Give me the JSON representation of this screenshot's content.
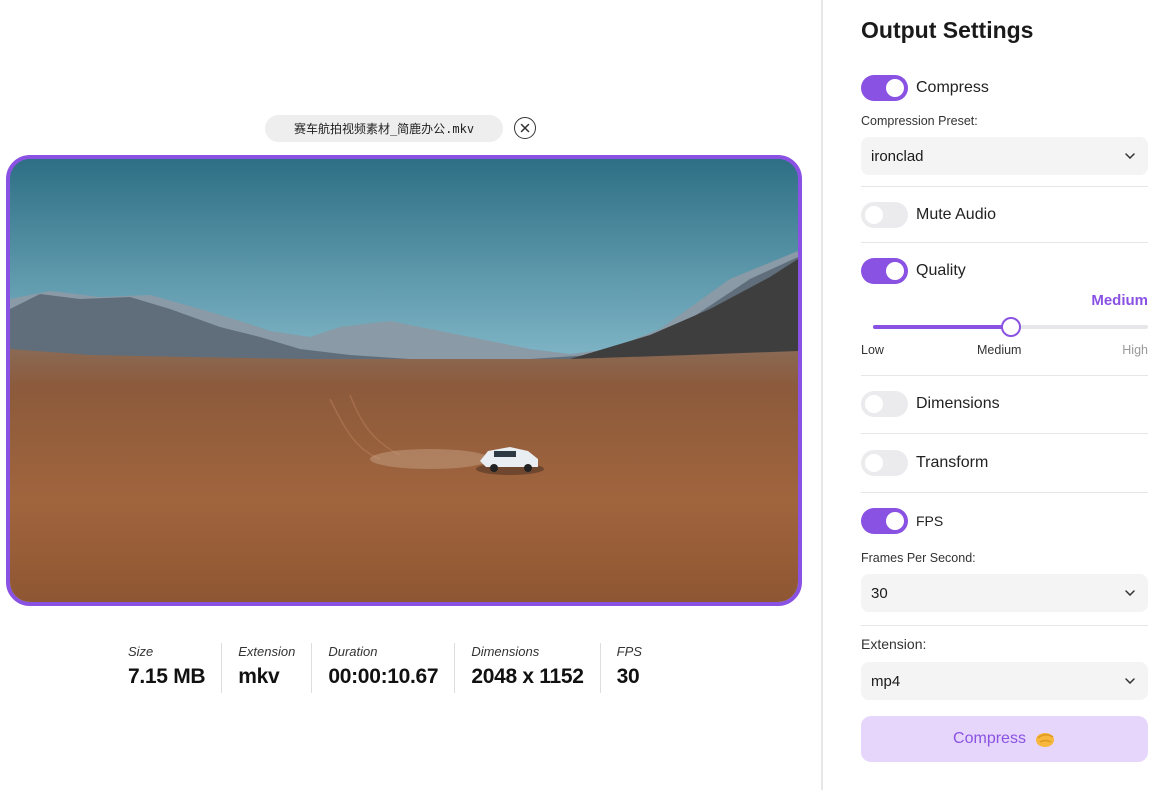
{
  "file": {
    "name": "赛车航拍视频素材_简鹿办公.mkv"
  },
  "stats": [
    {
      "label": "Size",
      "value": "7.15 MB"
    },
    {
      "label": "Extension",
      "value": "mkv"
    },
    {
      "label": "Duration",
      "value": "00:00:10.67"
    },
    {
      "label": "Dimensions",
      "value": "2048 x 1152"
    },
    {
      "label": "FPS",
      "value": "30"
    }
  ],
  "panel": {
    "title": "Output Settings",
    "compress_toggle": {
      "label": "Compress",
      "on": true
    },
    "compression_preset": {
      "label": "Compression Preset:",
      "value": "ironclad"
    },
    "mute_audio": {
      "label": "Mute Audio",
      "on": false
    },
    "quality": {
      "label": "Quality",
      "on": true,
      "value": "Medium",
      "level": 0.5,
      "ticks": {
        "low": "Low",
        "medium": "Medium",
        "high": "High"
      }
    },
    "dimensions": {
      "label": "Dimensions",
      "on": false
    },
    "transform": {
      "label": "Transform",
      "on": false
    },
    "fps": {
      "label": "FPS",
      "on": true,
      "field_label": "Frames Per Second:",
      "value": "30"
    },
    "extension": {
      "label": "Extension:",
      "value": "mp4"
    },
    "compress_button": {
      "label": "Compress"
    }
  },
  "colors": {
    "accent": "#8a52e2",
    "accent_light": "#e6d6fb",
    "field_bg": "#f4f4f5"
  },
  "icons": {
    "remove": "close-circle-icon",
    "chevron": "chevron-down-icon",
    "button": "pointing-hand-icon"
  }
}
